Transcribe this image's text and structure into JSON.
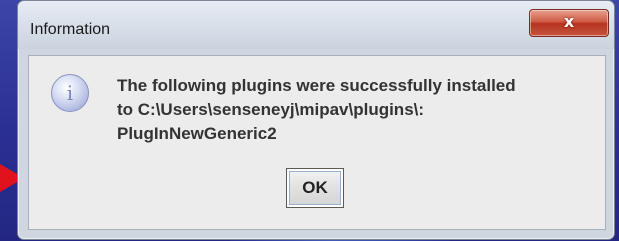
{
  "dialog": {
    "title": "Information",
    "close_label": "x",
    "icon": "info-icon",
    "message_lines": [
      "The following plugins were successfully installed",
      "to C:\\Users\\senseneyj\\mipav\\plugins\\:",
      "PlugInNewGeneric2"
    ],
    "ok_label": "OK"
  },
  "annotation": {
    "arrow_icon": "pointer-arrow-icon",
    "arrow_color": "#e0121b"
  },
  "colors": {
    "background": "#2b2f8f",
    "close_button": "#c6553e"
  }
}
